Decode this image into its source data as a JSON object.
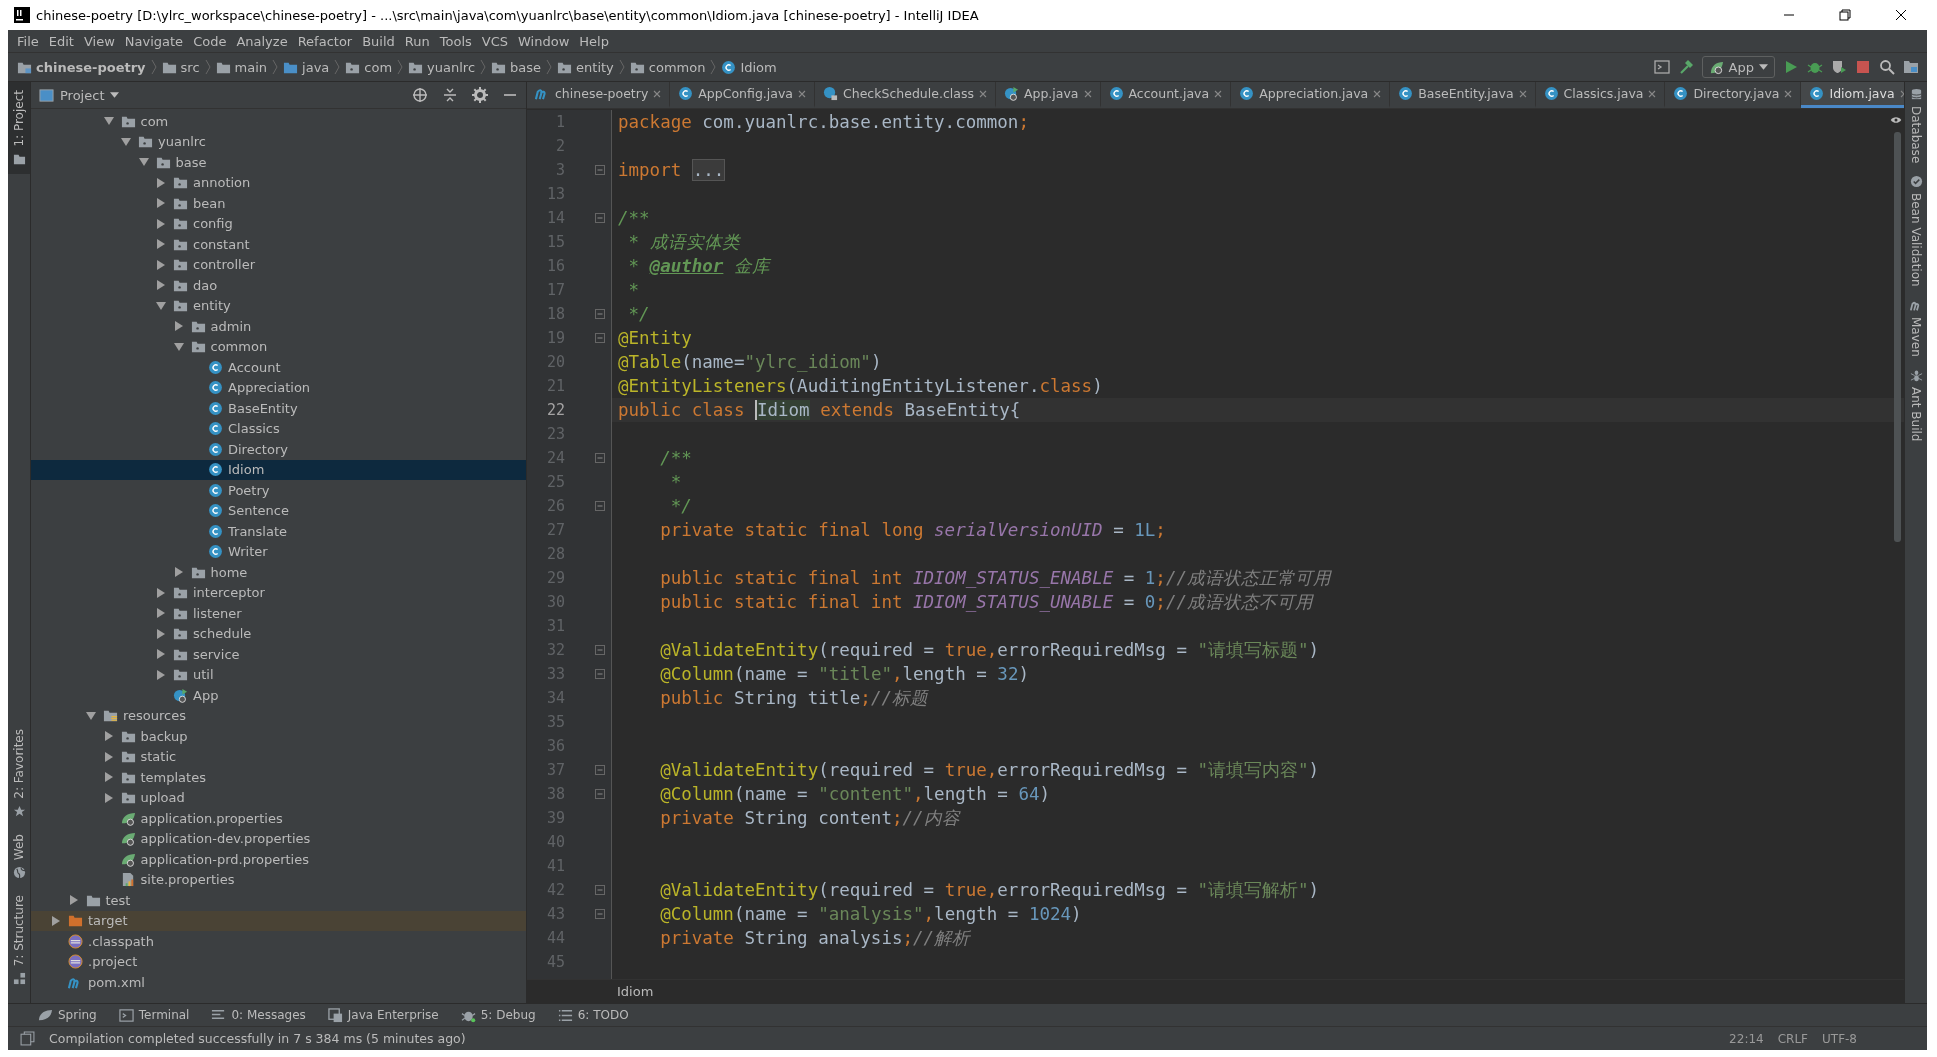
{
  "window": {
    "title": "chinese-poetry [D:\\ylrc_workspace\\chinese-poetry] - ...\\src\\main\\java\\com\\yuanlrc\\base\\entity\\common\\Idiom.java [chinese-poetry] - IntelliJ IDEA"
  },
  "menu": [
    "File",
    "Edit",
    "View",
    "Navigate",
    "Code",
    "Analyze",
    "Refactor",
    "Build",
    "Run",
    "Tools",
    "VCS",
    "Window",
    "Help"
  ],
  "breadcrumb": [
    {
      "label": "chinese-poetry",
      "kind": "module"
    },
    {
      "label": "src",
      "kind": "folder"
    },
    {
      "label": "main",
      "kind": "folder"
    },
    {
      "label": "java",
      "kind": "source"
    },
    {
      "label": "com",
      "kind": "package"
    },
    {
      "label": "yuanlrc",
      "kind": "package"
    },
    {
      "label": "base",
      "kind": "package"
    },
    {
      "label": "entity",
      "kind": "package"
    },
    {
      "label": "common",
      "kind": "package"
    },
    {
      "label": "Idiom",
      "kind": "class"
    }
  ],
  "run_config": {
    "label": "App"
  },
  "left_tools": [
    {
      "label": "1: Project",
      "kind": "folder",
      "selected": true
    },
    {
      "label": "2: Favorites",
      "kind": "star",
      "selected": false
    },
    {
      "label": "Web",
      "kind": "globe",
      "selected": false
    },
    {
      "label": "7: Structure",
      "kind": "structure",
      "selected": false
    }
  ],
  "project_panel": {
    "title": "Project"
  },
  "tree": [
    {
      "children": [
        {
          "children": [
            {
              "children": [
                {
                  "label": "com",
                  "kind": "package",
                  "expanded": true,
                  "selected": false,
                  "children": [
                    {
                      "label": "yuanlrc",
                      "kind": "package",
                      "expanded": true,
                      "selected": false,
                      "children": [
                        {
                          "label": "base",
                          "kind": "package",
                          "expanded": true,
                          "selected": false,
                          "children": [
                            {
                              "label": "annotion",
                              "kind": "package",
                              "expanded": false,
                              "selected": false
                            },
                            {
                              "label": "bean",
                              "kind": "package",
                              "expanded": false,
                              "selected": false
                            },
                            {
                              "label": "config",
                              "kind": "package",
                              "expanded": false,
                              "selected": false
                            },
                            {
                              "label": "constant",
                              "kind": "package",
                              "expanded": false,
                              "selected": false
                            },
                            {
                              "label": "controller",
                              "kind": "package",
                              "expanded": false,
                              "selected": false
                            },
                            {
                              "label": "dao",
                              "kind": "package",
                              "expanded": false,
                              "selected": false
                            },
                            {
                              "label": "entity",
                              "kind": "package",
                              "expanded": true,
                              "selected": false,
                              "children": [
                                {
                                  "label": "admin",
                                  "kind": "package",
                                  "expanded": false,
                                  "selected": false
                                },
                                {
                                  "label": "common",
                                  "kind": "package",
                                  "expanded": true,
                                  "selected": false,
                                  "children": [
                                    {
                                      "label": "Account",
                                      "kind": "class",
                                      "selected": false
                                    },
                                    {
                                      "label": "Appreciation",
                                      "kind": "class",
                                      "selected": false
                                    },
                                    {
                                      "label": "BaseEntity",
                                      "kind": "class",
                                      "selected": false
                                    },
                                    {
                                      "label": "Classics",
                                      "kind": "class",
                                      "selected": false
                                    },
                                    {
                                      "label": "Directory",
                                      "kind": "class",
                                      "selected": false
                                    },
                                    {
                                      "label": "Idiom",
                                      "kind": "class",
                                      "selected": true
                                    },
                                    {
                                      "label": "Poetry",
                                      "kind": "class",
                                      "selected": false
                                    },
                                    {
                                      "label": "Sentence",
                                      "kind": "class",
                                      "selected": false
                                    },
                                    {
                                      "label": "Translate",
                                      "kind": "class",
                                      "selected": false
                                    },
                                    {
                                      "label": "Writer",
                                      "kind": "class",
                                      "selected": false
                                    }
                                  ]
                                },
                                {
                                  "label": "home",
                                  "kind": "package",
                                  "expanded": false,
                                  "selected": false
                                }
                              ]
                            },
                            {
                              "label": "interceptor",
                              "kind": "package",
                              "expanded": false,
                              "selected": false
                            },
                            {
                              "label": "listener",
                              "kind": "package",
                              "expanded": false,
                              "selected": false
                            },
                            {
                              "label": "schedule",
                              "kind": "package",
                              "expanded": false,
                              "selected": false
                            },
                            {
                              "label": "service",
                              "kind": "package",
                              "expanded": false,
                              "selected": false
                            },
                            {
                              "label": "util",
                              "kind": "package",
                              "expanded": false,
                              "selected": false
                            },
                            {
                              "label": "App",
                              "kind": "app",
                              "selected": false
                            }
                          ]
                        }
                      ]
                    }
                  ]
                }
              ]
            },
            {
              "label": "resources",
              "kind": "resources",
              "expanded": true,
              "selected": false,
              "children": [
                {
                  "label": "backup",
                  "kind": "package",
                  "expanded": false,
                  "selected": false
                },
                {
                  "label": "static",
                  "kind": "package",
                  "expanded": false,
                  "selected": false
                },
                {
                  "label": "templates",
                  "kind": "package",
                  "expanded": false,
                  "selected": false
                },
                {
                  "label": "upload",
                  "kind": "package",
                  "expanded": false,
                  "selected": false
                },
                {
                  "label": "application.properties",
                  "kind": "spring",
                  "selected": false
                },
                {
                  "label": "application-dev.properties",
                  "kind": "spring",
                  "selected": false
                },
                {
                  "label": "application-prd.properties",
                  "kind": "spring",
                  "selected": false
                },
                {
                  "label": "site.properties",
                  "kind": "props",
                  "selected": false
                }
              ]
            }
          ]
        },
        {
          "label": "test",
          "kind": "folder",
          "expanded": false,
          "selected": false
        }
      ]
    },
    {
      "label": "target",
      "kind": "excluded",
      "expanded": false,
      "selected": false
    },
    {
      "label": ".classpath",
      "kind": "eclipse",
      "selected": false
    },
    {
      "label": ".project",
      "kind": "eclipse",
      "selected": false
    },
    {
      "label": "pom.xml",
      "kind": "maven",
      "selected": false
    }
  ],
  "tabs": [
    {
      "label": "chinese-poetry",
      "kind": "maven",
      "selected": false
    },
    {
      "label": "AppConfig.java",
      "kind": "class",
      "selected": false
    },
    {
      "label": "CheckSchedule.class",
      "kind": "locked",
      "selected": false
    },
    {
      "label": "App.java",
      "kind": "app",
      "selected": false
    },
    {
      "label": "Account.java",
      "kind": "class",
      "selected": false
    },
    {
      "label": "Appreciation.java",
      "kind": "class",
      "selected": false
    },
    {
      "label": "BaseEntity.java",
      "kind": "class",
      "selected": false
    },
    {
      "label": "Classics.java",
      "kind": "class",
      "selected": false
    },
    {
      "label": "Directory.java",
      "kind": "class",
      "selected": false
    },
    {
      "label": "Idiom.java",
      "kind": "class",
      "selected": true
    }
  ],
  "code_lines": [
    {
      "n": "1",
      "fold": false,
      "current": false,
      "tokens": [
        {
          "kind": "kw",
          "text": "package "
        },
        {
          "kind": "txt",
          "text": "com.yuanlrc.base.entity.common"
        },
        {
          "kind": "kw",
          "text": ";"
        }
      ]
    },
    {
      "n": "2",
      "fold": false,
      "current": false
    },
    {
      "n": "3",
      "fold": true,
      "current": false,
      "tokens": [
        {
          "kind": "kw",
          "text": "import "
        },
        {
          "kind": "folded",
          "text": "..."
        }
      ]
    },
    {
      "n": "13",
      "fold": false,
      "current": false
    },
    {
      "n": "14",
      "fold": true,
      "current": false,
      "tokens": [
        {
          "kind": "doc",
          "text": "/**"
        }
      ]
    },
    {
      "n": "15",
      "fold": false,
      "current": false,
      "tokens": [
        {
          "kind": "doc",
          "text": " * 成语实体类"
        }
      ]
    },
    {
      "n": "16",
      "fold": false,
      "current": false,
      "tokens": [
        {
          "kind": "doc",
          "text": " * "
        },
        {
          "kind": "tag",
          "text": "@author"
        },
        {
          "kind": "doc",
          "text": " 金库"
        }
      ]
    },
    {
      "n": "17",
      "fold": false,
      "current": false,
      "tokens": [
        {
          "kind": "doc",
          "text": " *"
        }
      ]
    },
    {
      "n": "18",
      "fold": true,
      "current": false,
      "tokens": [
        {
          "kind": "doc",
          "text": " */"
        }
      ]
    },
    {
      "n": "19",
      "fold": true,
      "current": false,
      "tokens": [
        {
          "kind": "ann",
          "text": "@Entity"
        }
      ]
    },
    {
      "n": "20",
      "fold": false,
      "current": false,
      "tokens": [
        {
          "kind": "ann",
          "text": "@Table"
        },
        {
          "kind": "txt",
          "text": "(name="
        },
        {
          "kind": "str",
          "text": "\"ylrc_idiom\""
        },
        {
          "kind": "txt",
          "text": ")"
        }
      ]
    },
    {
      "n": "21",
      "fold": false,
      "current": false,
      "tokens": [
        {
          "kind": "ann",
          "text": "@EntityListeners"
        },
        {
          "kind": "txt",
          "text": "(AuditingEntityListener."
        },
        {
          "kind": "kw",
          "text": "class"
        },
        {
          "kind": "txt",
          "text": ")"
        }
      ]
    },
    {
      "n": "22",
      "fold": false,
      "current": true,
      "tokens": [
        {
          "kind": "kw",
          "text": "public class "
        },
        {
          "kind": "ident",
          "text": "Idiom"
        },
        {
          "kind": "kw",
          "text": " extends "
        },
        {
          "kind": "txt",
          "text": "BaseEntity{"
        }
      ]
    },
    {
      "n": "23",
      "fold": false,
      "current": false
    },
    {
      "n": "24",
      "fold": true,
      "current": false,
      "tokens": [
        {
          "kind": "doc",
          "text": "    /**"
        }
      ]
    },
    {
      "n": "25",
      "fold": false,
      "current": false,
      "tokens": [
        {
          "kind": "doc",
          "text": "     *"
        }
      ]
    },
    {
      "n": "26",
      "fold": true,
      "current": false,
      "tokens": [
        {
          "kind": "doc",
          "text": "     */"
        }
      ]
    },
    {
      "n": "27",
      "fold": false,
      "current": false,
      "tokens": [
        {
          "kind": "kw",
          "text": "    private static final long "
        },
        {
          "kind": "fld",
          "text": "serialVersionUID"
        },
        {
          "kind": "txt",
          "text": " = "
        },
        {
          "kind": "num",
          "text": "1L"
        },
        {
          "kind": "kw",
          "text": ";"
        }
      ]
    },
    {
      "n": "28",
      "fold": false,
      "current": false
    },
    {
      "n": "29",
      "fold": false,
      "current": false,
      "tokens": [
        {
          "kind": "kw",
          "text": "    public static final int "
        },
        {
          "kind": "fld",
          "text": "IDIOM_STATUS_ENABLE"
        },
        {
          "kind": "txt",
          "text": " = "
        },
        {
          "kind": "num",
          "text": "1"
        },
        {
          "kind": "kw",
          "text": ";"
        },
        {
          "kind": "cmt",
          "text": "//成语状态正常可用"
        }
      ]
    },
    {
      "n": "30",
      "fold": false,
      "current": false,
      "tokens": [
        {
          "kind": "kw",
          "text": "    public static final int "
        },
        {
          "kind": "fld",
          "text": "IDIOM_STATUS_UNABLE"
        },
        {
          "kind": "txt",
          "text": " = "
        },
        {
          "kind": "num",
          "text": "0"
        },
        {
          "kind": "kw",
          "text": ";"
        },
        {
          "kind": "cmt",
          "text": "//成语状态不可用"
        }
      ]
    },
    {
      "n": "31",
      "fold": false,
      "current": false
    },
    {
      "n": "32",
      "fold": true,
      "current": false,
      "tokens": [
        {
          "kind": "ann",
          "text": "    @ValidateEntity"
        },
        {
          "kind": "txt",
          "text": "(required = "
        },
        {
          "kind": "kw",
          "text": "true,"
        },
        {
          "kind": "txt",
          "text": "errorRequiredMsg = "
        },
        {
          "kind": "str",
          "text": "\"请填写标题\""
        },
        {
          "kind": "txt",
          "text": ")"
        }
      ]
    },
    {
      "n": "33",
      "fold": true,
      "current": false,
      "tokens": [
        {
          "kind": "ann",
          "text": "    @Column"
        },
        {
          "kind": "txt",
          "text": "(name = "
        },
        {
          "kind": "str",
          "text": "\"title\""
        },
        {
          "kind": "kw",
          "text": ","
        },
        {
          "kind": "txt",
          "text": "length = "
        },
        {
          "kind": "num",
          "text": "32"
        },
        {
          "kind": "txt",
          "text": ")"
        }
      ]
    },
    {
      "n": "34",
      "fold": false,
      "current": false,
      "tokens": [
        {
          "kind": "kw",
          "text": "    public "
        },
        {
          "kind": "txt",
          "text": "String title"
        },
        {
          "kind": "kw",
          "text": ";"
        },
        {
          "kind": "cmt",
          "text": "//标题"
        }
      ]
    },
    {
      "n": "35",
      "fold": false,
      "current": false
    },
    {
      "n": "36",
      "fold": false,
      "current": false
    },
    {
      "n": "37",
      "fold": true,
      "current": false,
      "tokens": [
        {
          "kind": "ann",
          "text": "    @ValidateEntity"
        },
        {
          "kind": "txt",
          "text": "(required = "
        },
        {
          "kind": "kw",
          "text": "true,"
        },
        {
          "kind": "txt",
          "text": "errorRequiredMsg = "
        },
        {
          "kind": "str",
          "text": "\"请填写内容\""
        },
        {
          "kind": "txt",
          "text": ")"
        }
      ]
    },
    {
      "n": "38",
      "fold": true,
      "current": false,
      "tokens": [
        {
          "kind": "ann",
          "text": "    @Column"
        },
        {
          "kind": "txt",
          "text": "(name = "
        },
        {
          "kind": "str",
          "text": "\"content\""
        },
        {
          "kind": "kw",
          "text": ","
        },
        {
          "kind": "txt",
          "text": "length = "
        },
        {
          "kind": "num",
          "text": "64"
        },
        {
          "kind": "txt",
          "text": ")"
        }
      ]
    },
    {
      "n": "39",
      "fold": false,
      "current": false,
      "tokens": [
        {
          "kind": "kw",
          "text": "    private "
        },
        {
          "kind": "txt",
          "text": "String content"
        },
        {
          "kind": "kw",
          "text": ";"
        },
        {
          "kind": "cmt",
          "text": "//内容"
        }
      ]
    },
    {
      "n": "40",
      "fold": false,
      "current": false
    },
    {
      "n": "41",
      "fold": false,
      "current": false
    },
    {
      "n": "42",
      "fold": true,
      "current": false,
      "tokens": [
        {
          "kind": "ann",
          "text": "    @ValidateEntity"
        },
        {
          "kind": "txt",
          "text": "(required = "
        },
        {
          "kind": "kw",
          "text": "true,"
        },
        {
          "kind": "txt",
          "text": "errorRequiredMsg = "
        },
        {
          "kind": "str",
          "text": "\"请填写解析\""
        },
        {
          "kind": "txt",
          "text": ")"
        }
      ]
    },
    {
      "n": "43",
      "fold": true,
      "current": false,
      "tokens": [
        {
          "kind": "ann",
          "text": "    @Column"
        },
        {
          "kind": "txt",
          "text": "(name = "
        },
        {
          "kind": "str",
          "text": "\"analysis\""
        },
        {
          "kind": "kw",
          "text": ","
        },
        {
          "kind": "txt",
          "text": "length = "
        },
        {
          "kind": "num",
          "text": "1024"
        },
        {
          "kind": "txt",
          "text": ")"
        }
      ]
    },
    {
      "n": "44",
      "fold": false,
      "current": false,
      "tokens": [
        {
          "kind": "kw",
          "text": "    private "
        },
        {
          "kind": "txt",
          "text": "String analysis"
        },
        {
          "kind": "kw",
          "text": ";"
        },
        {
          "kind": "cmt",
          "text": "//解析"
        }
      ]
    },
    {
      "n": "45",
      "fold": false,
      "current": false
    }
  ],
  "editor_breadcrumb": "Idiom",
  "right_tools": [
    {
      "label": "Database",
      "kind": "database"
    },
    {
      "label": "Bean Validation",
      "kind": "bean"
    },
    {
      "label": "Maven",
      "kind": "maven"
    },
    {
      "label": "Ant Build",
      "kind": "ant"
    }
  ],
  "bottom_tools": [
    {
      "label": "Spring",
      "kind": "spring"
    },
    {
      "label": "Terminal",
      "kind": "terminal"
    },
    {
      "label": "0: Messages",
      "kind": "messages"
    },
    {
      "label": "Java Enterprise",
      "kind": "enterprise"
    },
    {
      "label": "5: Debug",
      "kind": "debug"
    },
    {
      "label": "6: TODO",
      "kind": "todo"
    }
  ],
  "status": {
    "message": "Compilation completed successfully in 7 s 384 ms (5 minutes ago)",
    "position": "22:14",
    "line_ending": "CRLF",
    "encoding": "UTF-8"
  }
}
